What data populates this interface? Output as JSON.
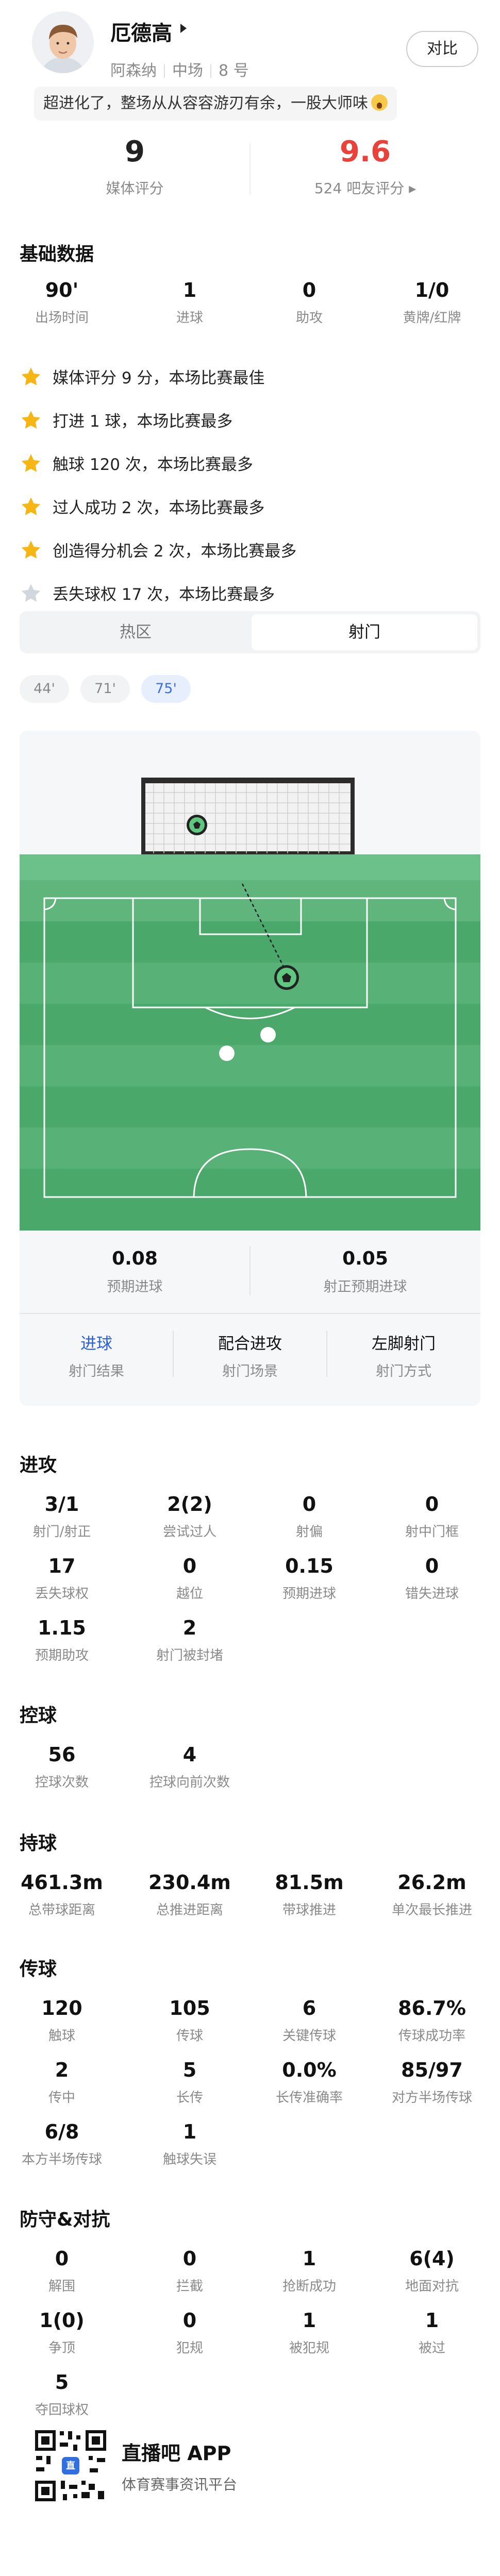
{
  "player": {
    "name": "厄德高",
    "team": "阿森纳",
    "position": "中场",
    "number": "8 号",
    "compare_label": "对比",
    "comment": "超进化了，整场从从容容游刃有余，一股大师味"
  },
  "ratings": {
    "media_score": "9",
    "media_label": "媒体评分",
    "fan_score": "9.6",
    "fan_label": "524 吧友评分 ▸",
    "fan_color": "#e8423a"
  },
  "basic": {
    "title": "基础数据",
    "items": [
      {
        "value": "90'",
        "label": "出场时间"
      },
      {
        "value": "1",
        "label": "进球"
      },
      {
        "value": "0",
        "label": "助攻"
      },
      {
        "value": "1/0",
        "label": "黄牌/红牌"
      }
    ],
    "highlights": [
      {
        "text": "媒体评分 9 分，本场比赛最佳",
        "star": "gold"
      },
      {
        "text": "打进 1 球，本场比赛最多",
        "star": "gold"
      },
      {
        "text": "触球 120 次，本场比赛最多",
        "star": "gold"
      },
      {
        "text": "过人成功 2 次，本场比赛最多",
        "star": "gold"
      },
      {
        "text": "创造得分机会 2 次，本场比赛最多",
        "star": "gold"
      },
      {
        "text": "丢失球权 17 次，本场比赛最多",
        "star": "grey"
      }
    ]
  },
  "tabs": {
    "heatmap": "热区",
    "shots": "射门",
    "active": "shots"
  },
  "shot_minutes": [
    "44'",
    "71'",
    "75'"
  ],
  "shot_active": "75'",
  "shot_card": {
    "xg_value": "0.08",
    "xg_label": "预期进球",
    "xgot_value": "0.05",
    "xgot_label": "射正预期进球",
    "result_value": "进球",
    "result_label": "射门结果",
    "scene_value": "配合进攻",
    "scene_label": "射门场景",
    "method_value": "左脚射门",
    "method_label": "射门方式"
  },
  "attack": {
    "title": "进攻",
    "items": [
      {
        "value": "3/1",
        "label": "射门/射正"
      },
      {
        "value": "2(2)",
        "label": "尝试过人"
      },
      {
        "value": "0",
        "label": "射偏"
      },
      {
        "value": "0",
        "label": "射中门框"
      },
      {
        "value": "17",
        "label": "丢失球权"
      },
      {
        "value": "0",
        "label": "越位"
      },
      {
        "value": "0.15",
        "label": "预期进球"
      },
      {
        "value": "0",
        "label": "错失进球"
      },
      {
        "value": "1.15",
        "label": "预期助攻"
      },
      {
        "value": "2",
        "label": "射门被封堵"
      }
    ]
  },
  "control": {
    "title": "控球",
    "items": [
      {
        "value": "56",
        "label": "控球次数"
      },
      {
        "value": "4",
        "label": "控球向前次数"
      }
    ]
  },
  "carry": {
    "title": "持球",
    "items": [
      {
        "value": "461.3m",
        "label": "总带球距离"
      },
      {
        "value": "230.4m",
        "label": "总推进距离"
      },
      {
        "value": "81.5m",
        "label": "带球推进"
      },
      {
        "value": "26.2m",
        "label": "单次最长推进"
      }
    ]
  },
  "passing": {
    "title": "传球",
    "items": [
      {
        "value": "120",
        "label": "触球"
      },
      {
        "value": "105",
        "label": "传球"
      },
      {
        "value": "6",
        "label": "关键传球"
      },
      {
        "value": "86.7%",
        "label": "传球成功率"
      },
      {
        "value": "2",
        "label": "传中"
      },
      {
        "value": "5",
        "label": "长传"
      },
      {
        "value": "0.0%",
        "label": "长传准确率"
      },
      {
        "value": "85/97",
        "label": "对方半场传球"
      },
      {
        "value": "6/8",
        "label": "本方半场传球"
      },
      {
        "value": "1",
        "label": "触球失误"
      }
    ]
  },
  "defense": {
    "title": "防守&对抗",
    "items": [
      {
        "value": "0",
        "label": "解围"
      },
      {
        "value": "0",
        "label": "拦截"
      },
      {
        "value": "1",
        "label": "抢断成功"
      },
      {
        "value": "6(4)",
        "label": "地面对抗"
      },
      {
        "value": "1(0)",
        "label": "争顶"
      },
      {
        "value": "0",
        "label": "犯规"
      },
      {
        "value": "1",
        "label": "被犯规"
      },
      {
        "value": "1",
        "label": "被过"
      },
      {
        "value": "5",
        "label": "夺回球权"
      }
    ]
  },
  "footer": {
    "app_name": "直播吧 APP",
    "subtitle": "体育赛事资讯平台"
  }
}
